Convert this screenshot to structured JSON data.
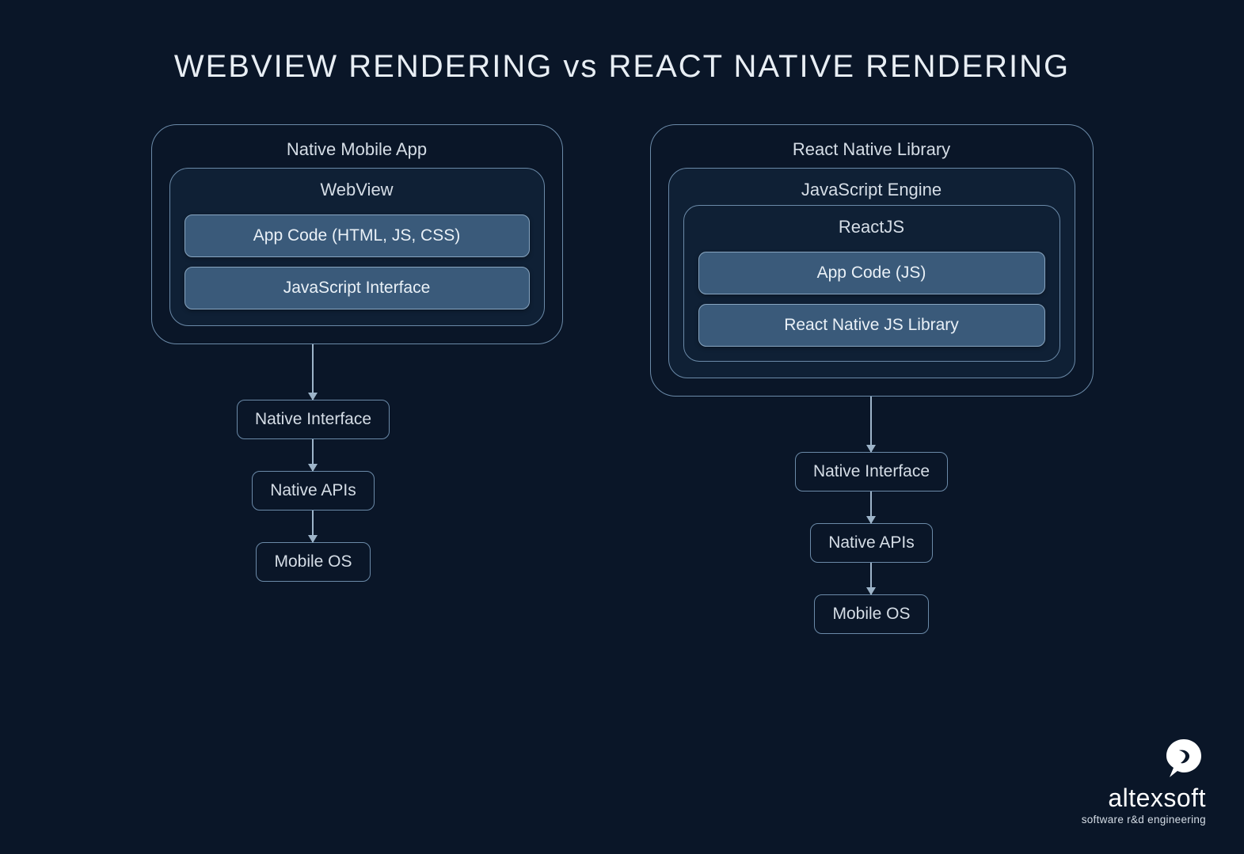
{
  "title": "WEBVIEW RENDERING vs REACT NATIVE RENDERING",
  "left": {
    "outer": "Native Mobile App",
    "mid": "WebView",
    "box1": "App Code (HTML, JS, CSS)",
    "box2": "JavaScript Interface",
    "flow1": "Native Interface",
    "flow2": "Native APIs",
    "flow3": "Mobile OS"
  },
  "right": {
    "outer": "React Native Library",
    "mid": "JavaScript Engine",
    "inner": "ReactJS",
    "box1": "App Code (JS)",
    "box2": "React Native JS Library",
    "flow1": "Native Interface",
    "flow2": "Native APIs",
    "flow3": "Mobile OS"
  },
  "logo": {
    "name": "altexsoft",
    "tag": "software r&d engineering"
  }
}
